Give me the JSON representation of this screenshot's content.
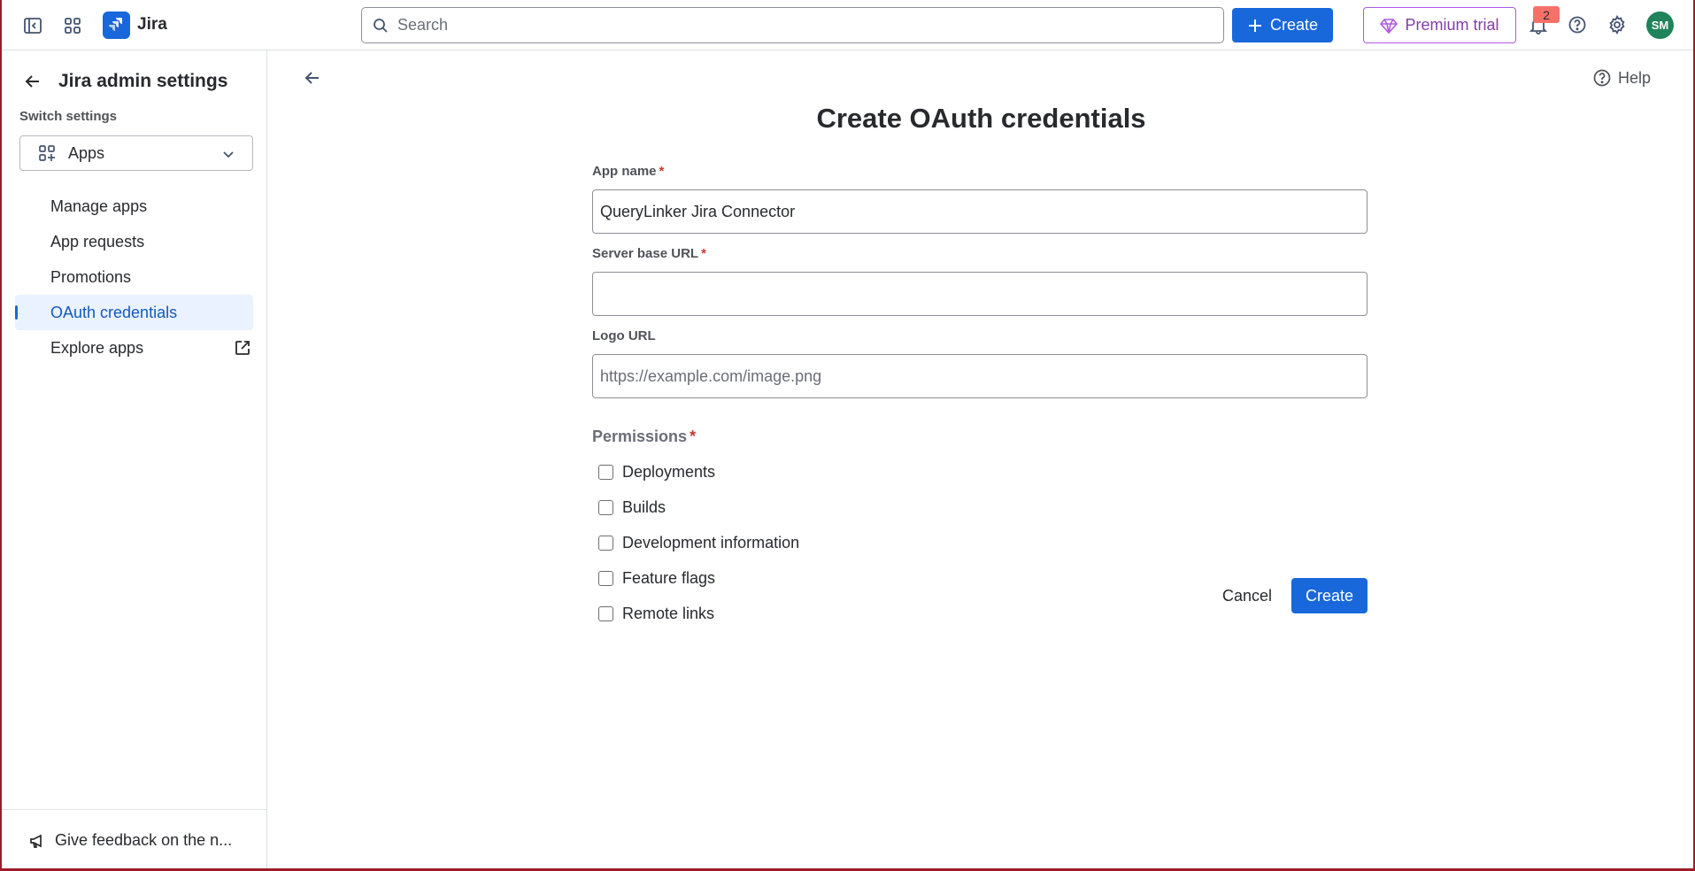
{
  "app": {
    "name": "Jira"
  },
  "topbar": {
    "search_placeholder": "Search",
    "create_label": "Create",
    "premium_label": "Premium trial",
    "notification_count": "2",
    "avatar_initials": "SM"
  },
  "sidebar": {
    "title": "Jira admin settings",
    "switch_label": "Switch settings",
    "selected": "Apps",
    "items": [
      {
        "label": "Manage apps"
      },
      {
        "label": "App requests"
      },
      {
        "label": "Promotions"
      },
      {
        "label": "OAuth credentials",
        "active": true
      },
      {
        "label": "Explore apps",
        "external": true
      }
    ],
    "footer": "Give feedback on the n..."
  },
  "main": {
    "help": "Help",
    "title": "Create OAuth credentials",
    "form": {
      "app_name_label": "App name",
      "app_name_value": "QueryLinker Jira Connector",
      "server_url_label": "Server base URL",
      "server_url_value": "",
      "logo_url_label": "Logo URL",
      "logo_url_placeholder": "https://example.com/image.png",
      "permissions_label": "Permissions",
      "permissions": [
        "Deployments",
        "Builds",
        "Development information",
        "Feature flags",
        "Remote links"
      ]
    },
    "cancel_label": "Cancel",
    "create_label": "Create"
  },
  "colors": {
    "brand": "#1868db",
    "premium": "#803fa5",
    "avatar": "#1f845a",
    "required": "#c9372c",
    "active_bg": "#e9f2fe"
  }
}
